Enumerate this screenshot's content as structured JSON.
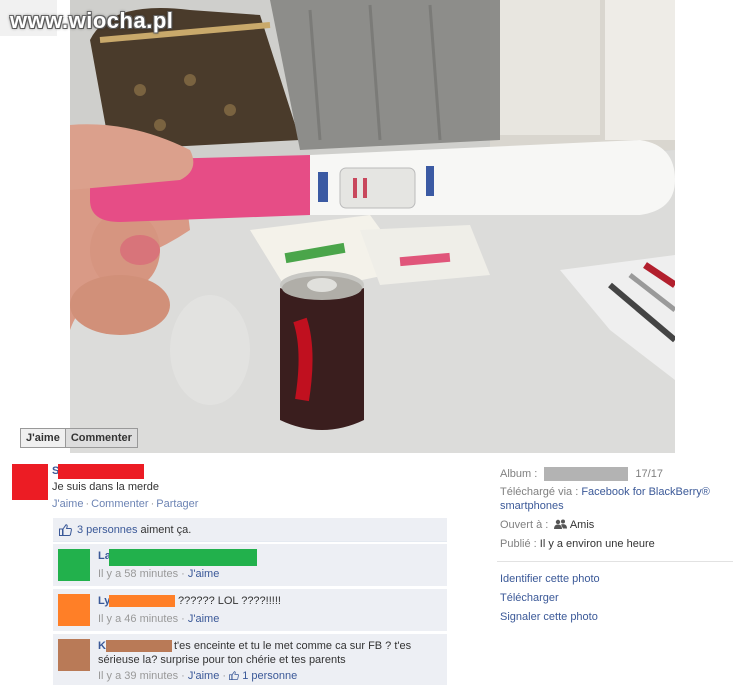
{
  "watermark": "www.wiocha.pl",
  "photo_buttons": {
    "like": "J'aime",
    "comment": "Commenter"
  },
  "post": {
    "author_initial": "S",
    "status": "Je suis dans la merde",
    "actions": {
      "like": "J'aime",
      "comment": "Commenter",
      "share": "Partager"
    }
  },
  "likes": {
    "count_link": "3 personnes",
    "text": "aiment ça."
  },
  "comments": [
    {
      "initial": "La",
      "text": "",
      "time": "Il y a 58 minutes",
      "like": "J'aime",
      "avatar_color": "#22b14c",
      "name_color": "#22b14c"
    },
    {
      "initial": "Ly",
      "text": "?????? LOL ????!!!!!",
      "time": "Il y a 46 minutes",
      "like": "J'aime",
      "avatar_color": "#ff7f27",
      "name_color": "#ff7f27"
    },
    {
      "initial": "K",
      "text_line1": "t'es enceinte et tu le met comme ca sur FB ? t'es",
      "text_line2": "sérieuse la? surprise pour ton chérie et tes parents",
      "time": "Il y a 39 minutes",
      "like": "J'aime",
      "like_count": "1 personne",
      "avatar_color": "#b97a57",
      "name_color": "#b97a57"
    }
  ],
  "sidebar": {
    "album_label": "Album :",
    "album_count": "17/17",
    "uploaded_label": "Téléchargé via :",
    "uploaded_link_line1": "Facebook for BlackBerry®",
    "uploaded_link_line2": "smartphones",
    "open_label": "Ouvert à :",
    "open_value": "Amis",
    "published_label": "Publié :",
    "published_value": "Il y a environ une heure",
    "actions": [
      "Identifier cette photo",
      "Télécharger",
      "Signaler cette photo"
    ]
  },
  "colors": {
    "fb_blue": "#3b5998",
    "feedback_bg": "#edeff4",
    "poster_red": "#ec1c24"
  }
}
